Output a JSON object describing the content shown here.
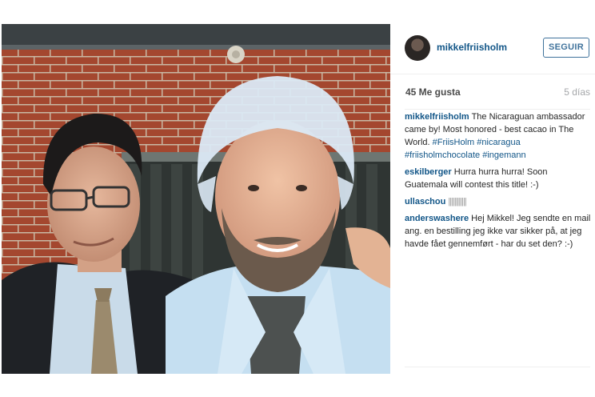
{
  "post": {
    "username": "mikkelfriisholm",
    "follow_label": "SEGUIR",
    "likes": "45 Me gusta",
    "time": "5 días"
  },
  "comments": [
    {
      "user": "mikkelfriisholm",
      "text": "The Nicaraguan ambassador came by! Most honored - best cacao in The World.",
      "tags": "#FriisHolm #nicaragua #friisholmchocolate #ingemann"
    },
    {
      "user": "eskilberger",
      "text": "Hurra hurra hurra! Soon Guatemala will contest this title! :-)"
    },
    {
      "user": "ullaschou",
      "text": "||||||||||||"
    },
    {
      "user": "anderswashere",
      "text": "Hej Mikkel! Jeg sendte en mail ang. en bestilling jeg ikke var sikker på, at jeg havde fået gennemført - har du set den? :-)"
    }
  ],
  "colors": {
    "link": "#125688",
    "follow_border": "#3f729b",
    "muted": "#a5a7aa"
  }
}
